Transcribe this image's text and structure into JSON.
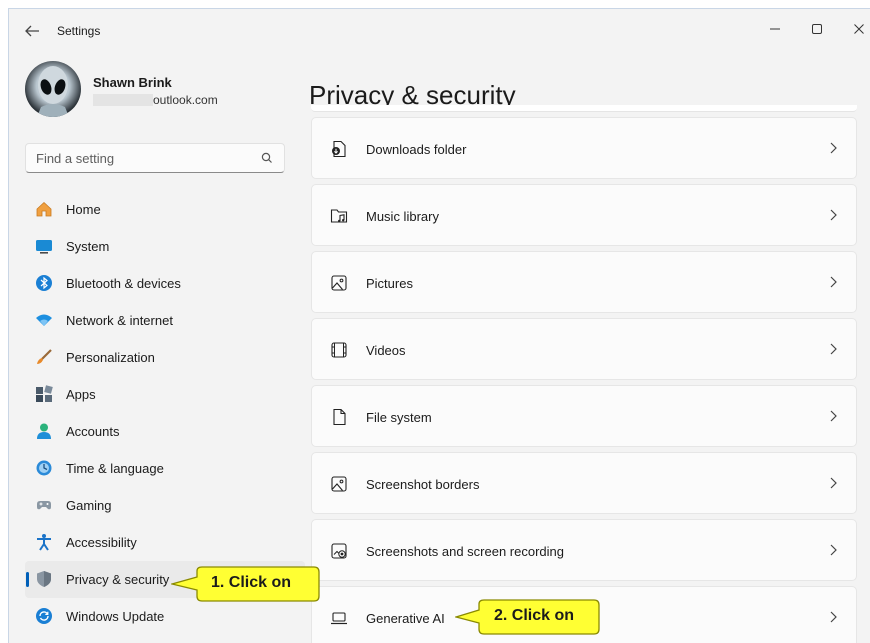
{
  "window": {
    "title": "Settings"
  },
  "profile": {
    "name": "Shawn Brink",
    "email_suffix": "outlook.com"
  },
  "search": {
    "placeholder": "Find a setting"
  },
  "page": {
    "title": "Privacy & security"
  },
  "nav": {
    "items": [
      {
        "label": "Home",
        "icon": "home-icon"
      },
      {
        "label": "System",
        "icon": "system-icon"
      },
      {
        "label": "Bluetooth & devices",
        "icon": "bluetooth-icon"
      },
      {
        "label": "Network & internet",
        "icon": "wifi-icon"
      },
      {
        "label": "Personalization",
        "icon": "brush-icon"
      },
      {
        "label": "Apps",
        "icon": "apps-icon"
      },
      {
        "label": "Accounts",
        "icon": "accounts-icon"
      },
      {
        "label": "Time & language",
        "icon": "time-language-icon"
      },
      {
        "label": "Gaming",
        "icon": "gamepad-icon"
      },
      {
        "label": "Accessibility",
        "icon": "accessibility-icon"
      },
      {
        "label": "Privacy & security",
        "icon": "shield-icon",
        "selected": true
      },
      {
        "label": "Windows Update",
        "icon": "update-icon"
      }
    ]
  },
  "main": {
    "items": [
      {
        "label": "Downloads folder",
        "icon": "download-folder-icon"
      },
      {
        "label": "Music library",
        "icon": "music-folder-icon"
      },
      {
        "label": "Pictures",
        "icon": "picture-icon"
      },
      {
        "label": "Videos",
        "icon": "video-icon"
      },
      {
        "label": "File system",
        "icon": "file-icon"
      },
      {
        "label": "Screenshot borders",
        "icon": "screenshot-border-icon"
      },
      {
        "label": "Screenshots and screen recording",
        "icon": "screen-recording-icon"
      },
      {
        "label": "Generative AI",
        "icon": "laptop-icon"
      }
    ]
  },
  "callouts": {
    "step1": "1. Click on",
    "step2": "2. Click on"
  },
  "colors": {
    "accent": "#005fb8",
    "callout_fill": "#ffff33",
    "callout_border": "#8a8a00"
  }
}
